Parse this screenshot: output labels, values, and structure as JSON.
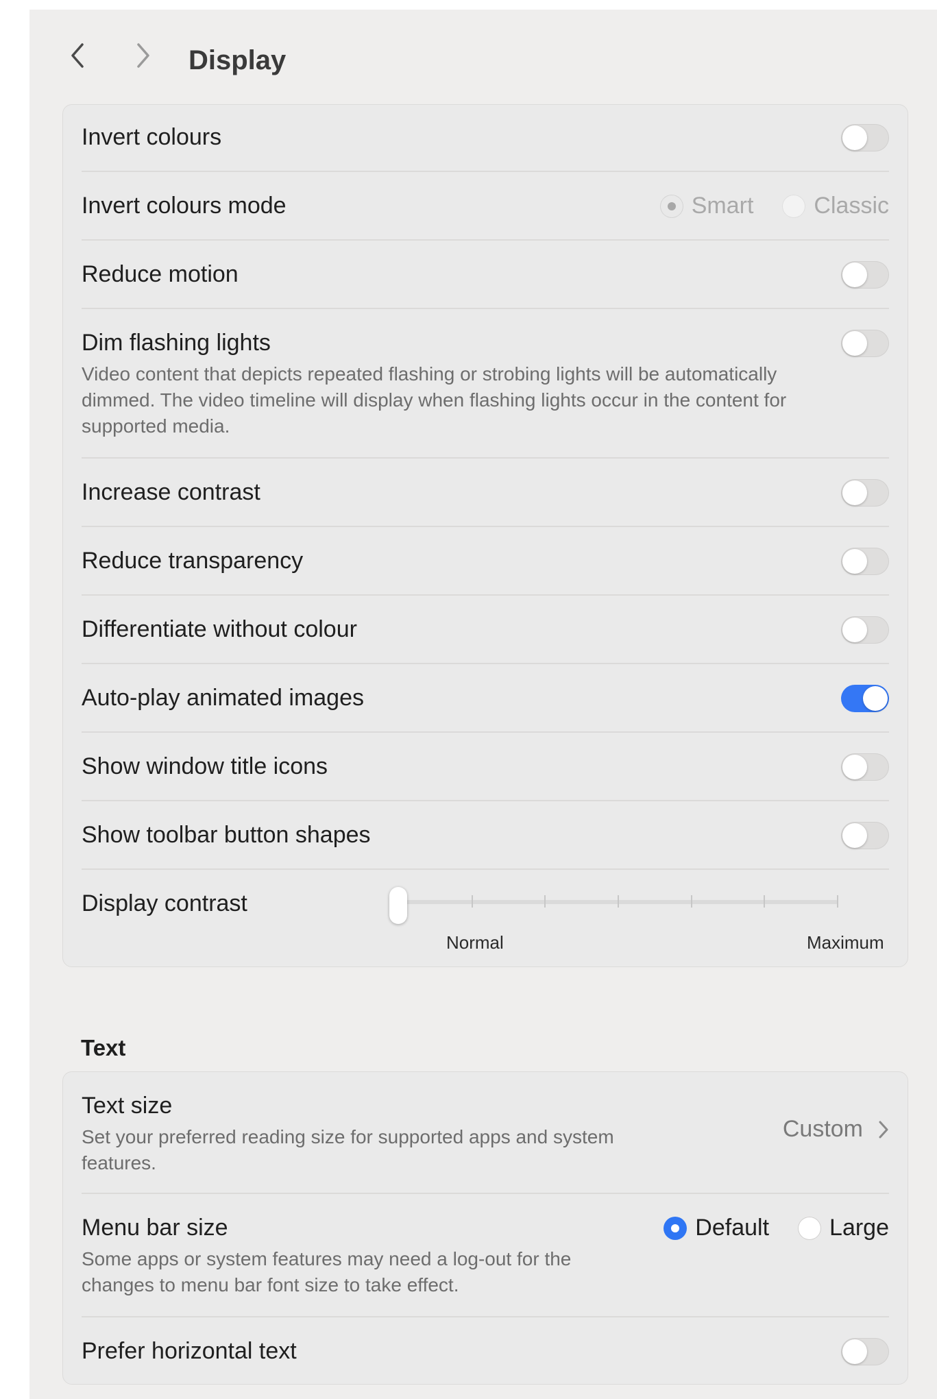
{
  "header": {
    "title": "Display"
  },
  "display": {
    "rows": [
      {
        "label": "Invert colours",
        "toggle": false
      },
      {
        "label": "Invert colours mode",
        "options": [
          "Smart",
          "Classic"
        ],
        "selected": "Smart",
        "enabled": false
      },
      {
        "label": "Reduce motion",
        "toggle": false
      },
      {
        "label": "Dim flashing lights",
        "desc": "Video content that depicts repeated flashing or strobing lights will be automatically dimmed. The video timeline will display when flashing lights occur in the content for supported media.",
        "toggle": false
      },
      {
        "label": "Increase contrast",
        "toggle": false
      },
      {
        "label": "Reduce transparency",
        "toggle": false
      },
      {
        "label": "Differentiate without colour",
        "toggle": false
      },
      {
        "label": "Auto-play animated images",
        "toggle": true
      },
      {
        "label": "Show window title icons",
        "toggle": false
      },
      {
        "label": "Show toolbar button shapes",
        "toggle": false
      },
      {
        "label": "Display contrast",
        "slider": {
          "min_label": "Normal",
          "max_label": "Maximum",
          "value": 0,
          "steps": 6
        }
      }
    ]
  },
  "text_section": {
    "heading": "Text",
    "text_size": {
      "label": "Text size",
      "desc": "Set your preferred reading size for supported apps and system features.",
      "value": "Custom"
    },
    "menu_bar_size": {
      "label": "Menu bar size",
      "desc": "Some apps or system features may need a log-out for the changes to menu bar font size to take effect.",
      "options": [
        "Default",
        "Large"
      ],
      "selected": "Default"
    },
    "prefer_horizontal": {
      "label": "Prefer horizontal text",
      "toggle": false
    }
  },
  "colors": {
    "accent": "#3477f5",
    "window_bg": "#efeeed",
    "card_bg": "#eaeaea"
  }
}
